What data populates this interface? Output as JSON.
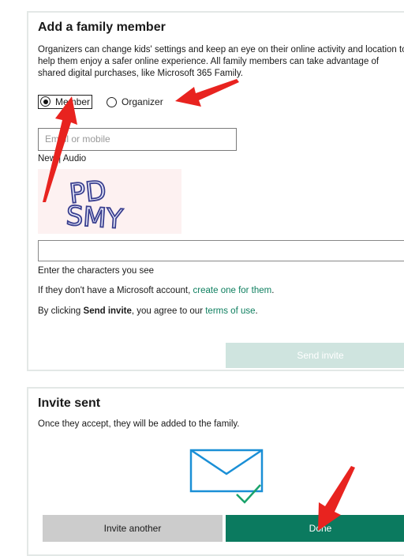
{
  "add_member": {
    "title": "Add a family member",
    "description": "Organizers can change kids' settings and keep an eye on their online activity and location to help them enjoy a safer online experience. All family members can take advantage of shared digital purchases, like Microsoft 365 Family.",
    "role_options": [
      {
        "label": "Member",
        "selected": true
      },
      {
        "label": "Organizer",
        "selected": false
      }
    ],
    "email_placeholder": "Email or mobile",
    "captcha_links": {
      "new": "New",
      "separator": " | ",
      "audio": "Audio"
    },
    "captcha_text": "PD SMY",
    "captcha_hint": "Enter the characters you see",
    "no_account_prefix": "If they don't have a Microsoft account, ",
    "no_account_link": "create one for them",
    "no_account_suffix": ".",
    "terms_prefix": "By clicking ",
    "terms_bold": "Send invite",
    "terms_middle": ", you agree to our ",
    "terms_link": "terms of use",
    "terms_suffix": ".",
    "send_button": "Send invite"
  },
  "invite_sent": {
    "title": "Invite sent",
    "message": "Once they accept, they will be added to the family.",
    "icon": "envelope-check-icon",
    "invite_another_button": "Invite another",
    "done_button": "Done"
  },
  "colors": {
    "accent": "#0b7a5f",
    "link": "#0e7f5f",
    "disabled_button": "#cfe4df",
    "annotation_arrow": "#e8231f"
  }
}
